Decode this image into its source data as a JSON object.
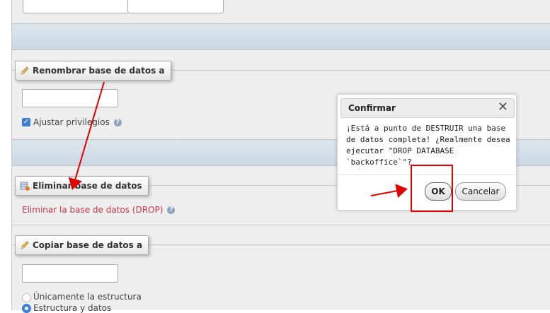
{
  "rename_section": {
    "legend": "Renombrar base de datos a",
    "new_name_value": "",
    "adjust_privileges_label": "Ajustar privilegios",
    "adjust_privileges_checked": true
  },
  "drop_section": {
    "legend": "Eliminar base de datos",
    "drop_link": "Eliminar la base de datos (DROP)"
  },
  "copy_section": {
    "legend": "Copiar base de datos a",
    "new_name_value": "",
    "options": [
      {
        "label": "Únicamente la estructura",
        "selected": false
      },
      {
        "label": "Estructura y datos",
        "selected": true
      }
    ]
  },
  "confirm_dialog": {
    "title": "Confirmar",
    "message": "¡Está a punto de DESTRUIR una base de datos completa! ¿Realmente desea ejecutar \"DROP DATABASE `backoffice`\"?",
    "ok_label": "OK",
    "cancel_label": "Cancelar"
  },
  "icons": {
    "legend_edit": "pencil-icon",
    "legend_drop": "database-delete-icon",
    "help": "help-icon",
    "close": "close-icon"
  },
  "colors": {
    "link": "#c8374a",
    "annotation": "#e10000",
    "checkbox": "#3c7ed8"
  }
}
